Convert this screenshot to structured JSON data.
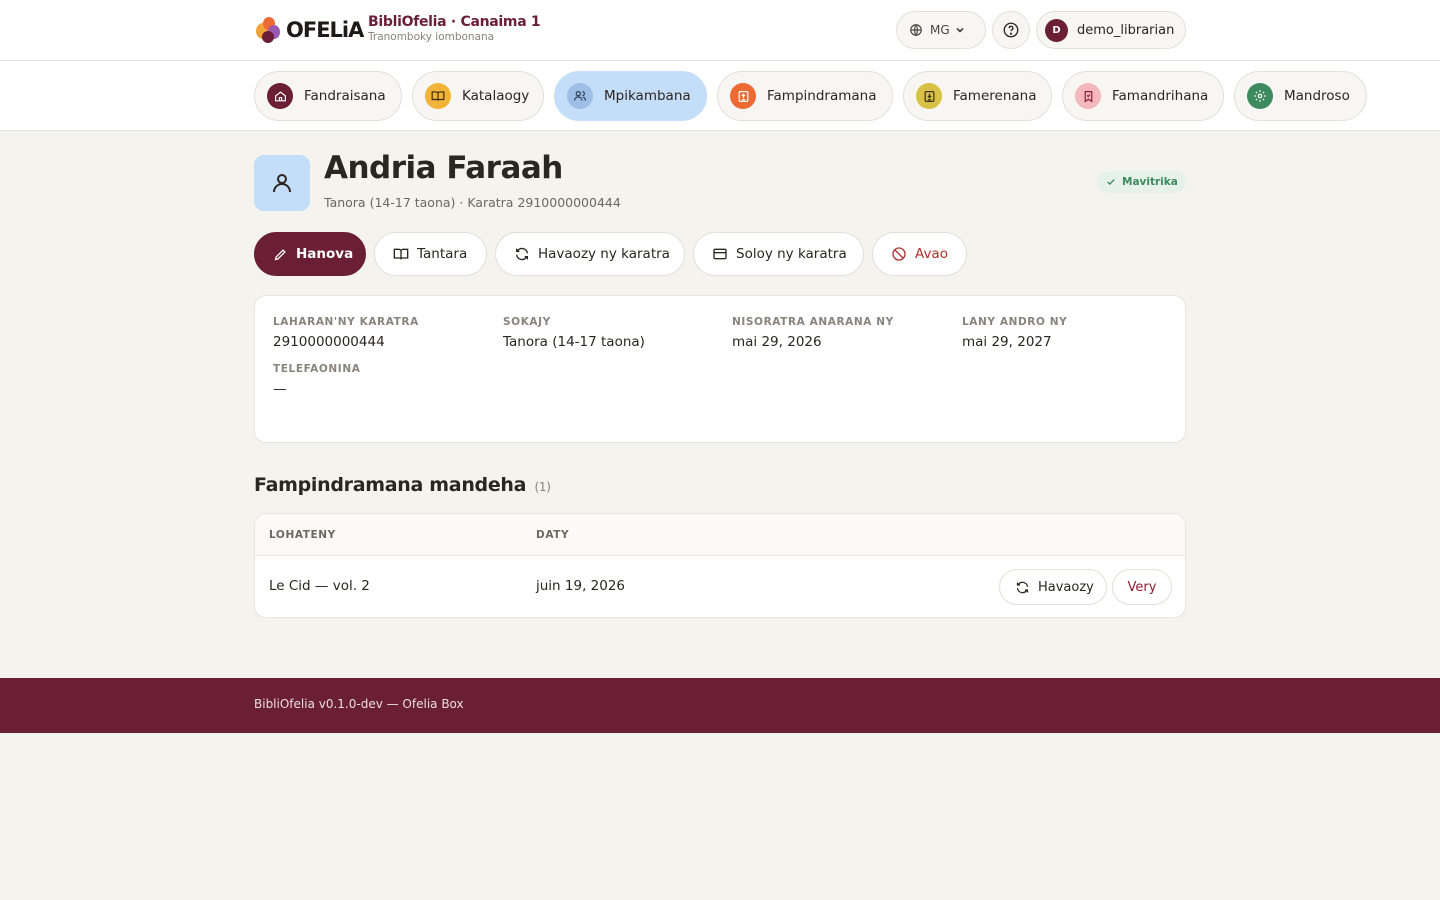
{
  "header": {
    "logo_text": "OFELiA",
    "brand_title": "BibliOfelia · Canaima 1",
    "brand_subtitle": "Tranomboky iombonana",
    "language": "MG",
    "user_initial": "D",
    "username": "demo_librarian"
  },
  "nav": {
    "items": [
      {
        "label": "Fandraisana",
        "icon": "home-icon",
        "color": "#6a1f37"
      },
      {
        "label": "Katalaogy",
        "icon": "book-open-icon",
        "color": "#f2b437"
      },
      {
        "label": "Mpikambana",
        "icon": "users-icon",
        "color": "#9dbfe6"
      },
      {
        "label": "Fampindramana",
        "icon": "book-upload-icon",
        "color": "#ec6a34"
      },
      {
        "label": "Famerenana",
        "icon": "book-download-icon",
        "color": "#d9c146"
      },
      {
        "label": "Famandrihana",
        "icon": "bookmark-icon",
        "color": "#f4b7bd"
      },
      {
        "label": "Mandroso",
        "icon": "gear-icon",
        "color": "#3e8a5e"
      }
    ]
  },
  "member": {
    "name": "Andria Faraah",
    "meta": "Tanora (14-17 taona) · Karatra 2910000000444",
    "status": "Mavitrika"
  },
  "actions": {
    "edit": "Hanova",
    "history": "Tantara",
    "renew_card": "Havaozy ny karatra",
    "replace_card": "Soloy ny karatra",
    "disable": "Avao"
  },
  "details": {
    "card_number_label": "LAHARAN'NY KARATRA",
    "card_number": "2910000000444",
    "category_label": "SOKAJY",
    "category": "Tanora (14-17 taona)",
    "registered_label": "NISORATRA ANARANA NY",
    "registered": "mai 29, 2026",
    "expires_label": "LANY ANDRO NY",
    "expires": "mai 29, 2027",
    "phone_label": "TELEFAONINA",
    "phone": "—"
  },
  "loans": {
    "title": "Fampindramana mandeha",
    "count": "(1)",
    "col_title": "LOHATENY",
    "col_date": "DATY",
    "rows": [
      {
        "title": "Le Cid — vol. 2",
        "date": "juin 19, 2026",
        "renew": "Havaozy",
        "return": "Very"
      }
    ]
  },
  "footer": {
    "text": "BibliOfelia v0.1.0-dev — Ofelia Box"
  },
  "colors": {
    "brand": "#6a1f37",
    "active_nav": "#c4ddf9",
    "status_green": "#3e8a5e",
    "danger": "#b0302d"
  }
}
